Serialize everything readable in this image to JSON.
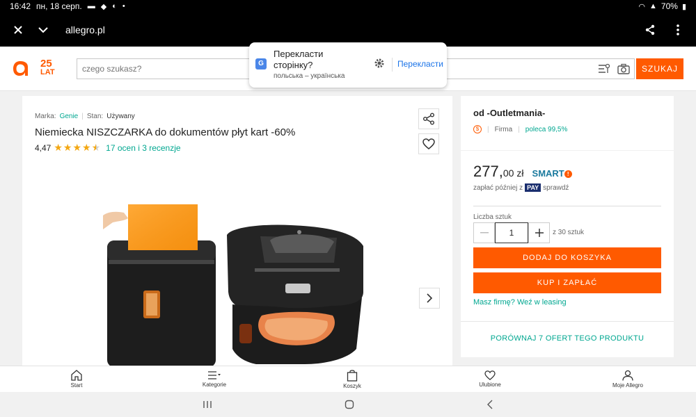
{
  "status": {
    "time": "16:42",
    "date": "пн, 18 серп.",
    "battery": "70%"
  },
  "browser": {
    "url": "allegro.pl"
  },
  "header": {
    "logo_anniversary_top": "25",
    "logo_anniversary_bottom": "LAT",
    "search_placeholder": "czego szukasz?",
    "search_button": "SZUKAJ"
  },
  "translate": {
    "title": "Перекласти сторінку?",
    "languages": "польська – українська",
    "action": "Перекласти"
  },
  "product": {
    "brand_label": "Marka:",
    "brand_value": "Genie",
    "state_label": "Stan:",
    "state_value": "Używany",
    "title": "Niemiecka NISZCZARKA do dokumentów płyt kart -60%",
    "rating": "4,47",
    "rating_stars": 4.47,
    "reviews": "17 ocen i 3 recenzje"
  },
  "seller": {
    "name": "od -Outletmania-",
    "type": "Firma",
    "recommend": "poleca 99,5%"
  },
  "buy": {
    "price_int": "277,",
    "price_dec": "00",
    "currency": "zł",
    "smart": "SMART",
    "paylater_prefix": "zapłać później z",
    "pay_badge": "PAY",
    "paylater_suffix": "sprawdź",
    "qty_label": "Liczba sztuk",
    "qty_value": "1",
    "qty_of": "z 30 sztuk",
    "add_to_cart": "DODAJ DO KOSZYKA",
    "buy_now": "KUP I ZAPŁAĆ",
    "leasing": "Masz firmę? Weź w leasing",
    "compare": "PORÓWNAJ 7 OFERT TEGO PRODUKTU"
  },
  "bottom_nav": [
    {
      "label": "Start",
      "icon": "home-icon"
    },
    {
      "label": "Kategorie",
      "icon": "menu-icon"
    },
    {
      "label": "Koszyk",
      "icon": "bag-icon"
    },
    {
      "label": "Ulubione",
      "icon": "heart-icon"
    },
    {
      "label": "Moje Allegro",
      "icon": "user-icon"
    }
  ],
  "colors": {
    "brand": "#ff5a00",
    "link": "#00a790"
  }
}
